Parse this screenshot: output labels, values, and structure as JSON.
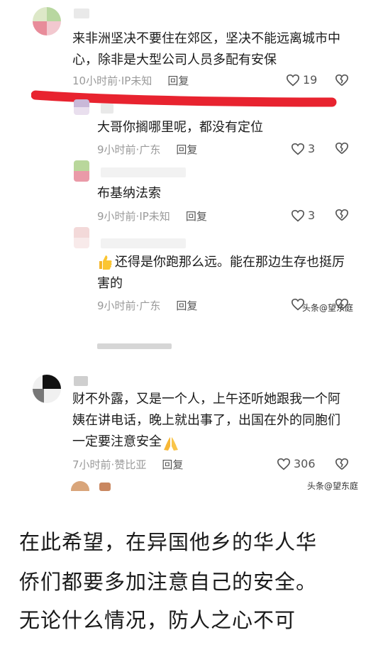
{
  "colors": {
    "accent_red": "#e8232f",
    "meta_gray": "#9a9a9a"
  },
  "comments": [
    {
      "text": "来非洲坚决不要住在郊区，坚决不能远离城市中心，除非是大型公司人员多配有安保",
      "time": "10小时前",
      "location": "IP未知",
      "reply_label": "回复",
      "likes": "19"
    },
    {
      "text": "大哥你搁哪里呢，都没有定位",
      "time": "9小时前",
      "location": "广东",
      "reply_label": "回复",
      "likes": "3"
    },
    {
      "text": "布基纳法索",
      "time": "9小时前",
      "location": "IP未知",
      "reply_label": "回复",
      "likes": "3"
    },
    {
      "text": "还得是你跑那么远。能在那边生存也挺厉害的",
      "emoji": "thumbs-up",
      "time": "9小时前",
      "location": "广东",
      "reply_label": "回复",
      "likes": ""
    },
    {
      "text": "财不外露，又是一个人，上午还听她跟我一个阿姨在讲电话，晚上就出事了，出国在外的同胞们一定要注意安全",
      "emoji": "praying-hands",
      "time": "7小时前",
      "location": "赞比亚",
      "reply_label": "回复",
      "likes": "306"
    }
  ],
  "watermark": "头条@望东庭",
  "article": {
    "line1": "在此希望，在异国他乡的华人华",
    "line2": "侨们都要多加注意自己的安全。",
    "line3": "无论什么情况，防人之心不可"
  }
}
